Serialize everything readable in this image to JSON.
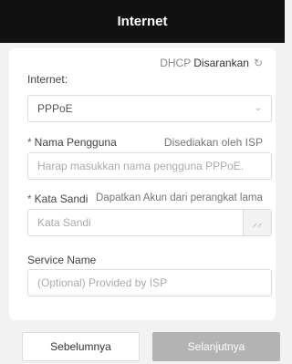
{
  "header": {
    "title": "Internet"
  },
  "dhcp": {
    "prefix": "DHCP",
    "link": "Disarankan",
    "icon": "refresh-icon"
  },
  "internet": {
    "label": "Internet:",
    "value": "PPPoE",
    "icon": "chevron-down-icon"
  },
  "username": {
    "label": "Nama Pengguna",
    "required_mark": "*",
    "hint": "Disediakan oleh ISP",
    "placeholder": "Harap masukkan nama pengguna PPPoE."
  },
  "password": {
    "label": "Kata Sandi",
    "required_mark": "*",
    "hint": "Dapatkan Akun dari perangkat lama",
    "placeholder": "Kata Sandi",
    "icon": "eye-closed-icon"
  },
  "service": {
    "label": "Service Name",
    "placeholder": "(Optional) Provided by ISP"
  },
  "buttons": {
    "prev": "Sebelumnya",
    "next": "Selanjutnya"
  }
}
